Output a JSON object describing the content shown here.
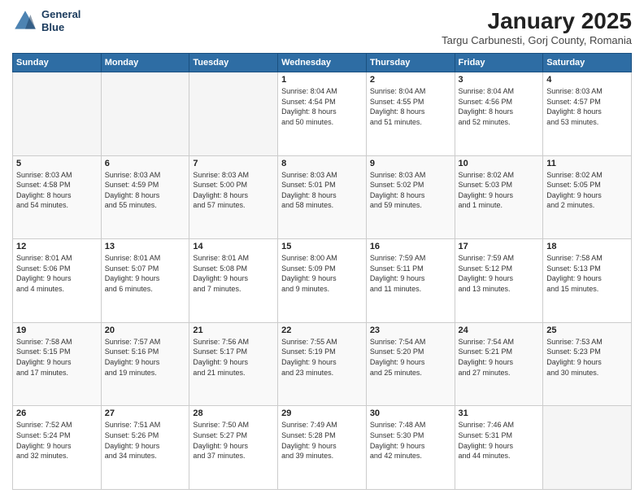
{
  "logo": {
    "line1": "General",
    "line2": "Blue"
  },
  "title": "January 2025",
  "subtitle": "Targu Carbunesti, Gorj County, Romania",
  "weekdays": [
    "Sunday",
    "Monday",
    "Tuesday",
    "Wednesday",
    "Thursday",
    "Friday",
    "Saturday"
  ],
  "weeks": [
    [
      {
        "day": "",
        "info": ""
      },
      {
        "day": "",
        "info": ""
      },
      {
        "day": "",
        "info": ""
      },
      {
        "day": "1",
        "info": "Sunrise: 8:04 AM\nSunset: 4:54 PM\nDaylight: 8 hours\nand 50 minutes."
      },
      {
        "day": "2",
        "info": "Sunrise: 8:04 AM\nSunset: 4:55 PM\nDaylight: 8 hours\nand 51 minutes."
      },
      {
        "day": "3",
        "info": "Sunrise: 8:04 AM\nSunset: 4:56 PM\nDaylight: 8 hours\nand 52 minutes."
      },
      {
        "day": "4",
        "info": "Sunrise: 8:03 AM\nSunset: 4:57 PM\nDaylight: 8 hours\nand 53 minutes."
      }
    ],
    [
      {
        "day": "5",
        "info": "Sunrise: 8:03 AM\nSunset: 4:58 PM\nDaylight: 8 hours\nand 54 minutes."
      },
      {
        "day": "6",
        "info": "Sunrise: 8:03 AM\nSunset: 4:59 PM\nDaylight: 8 hours\nand 55 minutes."
      },
      {
        "day": "7",
        "info": "Sunrise: 8:03 AM\nSunset: 5:00 PM\nDaylight: 8 hours\nand 57 minutes."
      },
      {
        "day": "8",
        "info": "Sunrise: 8:03 AM\nSunset: 5:01 PM\nDaylight: 8 hours\nand 58 minutes."
      },
      {
        "day": "9",
        "info": "Sunrise: 8:03 AM\nSunset: 5:02 PM\nDaylight: 8 hours\nand 59 minutes."
      },
      {
        "day": "10",
        "info": "Sunrise: 8:02 AM\nSunset: 5:03 PM\nDaylight: 9 hours\nand 1 minute."
      },
      {
        "day": "11",
        "info": "Sunrise: 8:02 AM\nSunset: 5:05 PM\nDaylight: 9 hours\nand 2 minutes."
      }
    ],
    [
      {
        "day": "12",
        "info": "Sunrise: 8:01 AM\nSunset: 5:06 PM\nDaylight: 9 hours\nand 4 minutes."
      },
      {
        "day": "13",
        "info": "Sunrise: 8:01 AM\nSunset: 5:07 PM\nDaylight: 9 hours\nand 6 minutes."
      },
      {
        "day": "14",
        "info": "Sunrise: 8:01 AM\nSunset: 5:08 PM\nDaylight: 9 hours\nand 7 minutes."
      },
      {
        "day": "15",
        "info": "Sunrise: 8:00 AM\nSunset: 5:09 PM\nDaylight: 9 hours\nand 9 minutes."
      },
      {
        "day": "16",
        "info": "Sunrise: 7:59 AM\nSunset: 5:11 PM\nDaylight: 9 hours\nand 11 minutes."
      },
      {
        "day": "17",
        "info": "Sunrise: 7:59 AM\nSunset: 5:12 PM\nDaylight: 9 hours\nand 13 minutes."
      },
      {
        "day": "18",
        "info": "Sunrise: 7:58 AM\nSunset: 5:13 PM\nDaylight: 9 hours\nand 15 minutes."
      }
    ],
    [
      {
        "day": "19",
        "info": "Sunrise: 7:58 AM\nSunset: 5:15 PM\nDaylight: 9 hours\nand 17 minutes."
      },
      {
        "day": "20",
        "info": "Sunrise: 7:57 AM\nSunset: 5:16 PM\nDaylight: 9 hours\nand 19 minutes."
      },
      {
        "day": "21",
        "info": "Sunrise: 7:56 AM\nSunset: 5:17 PM\nDaylight: 9 hours\nand 21 minutes."
      },
      {
        "day": "22",
        "info": "Sunrise: 7:55 AM\nSunset: 5:19 PM\nDaylight: 9 hours\nand 23 minutes."
      },
      {
        "day": "23",
        "info": "Sunrise: 7:54 AM\nSunset: 5:20 PM\nDaylight: 9 hours\nand 25 minutes."
      },
      {
        "day": "24",
        "info": "Sunrise: 7:54 AM\nSunset: 5:21 PM\nDaylight: 9 hours\nand 27 minutes."
      },
      {
        "day": "25",
        "info": "Sunrise: 7:53 AM\nSunset: 5:23 PM\nDaylight: 9 hours\nand 30 minutes."
      }
    ],
    [
      {
        "day": "26",
        "info": "Sunrise: 7:52 AM\nSunset: 5:24 PM\nDaylight: 9 hours\nand 32 minutes."
      },
      {
        "day": "27",
        "info": "Sunrise: 7:51 AM\nSunset: 5:26 PM\nDaylight: 9 hours\nand 34 minutes."
      },
      {
        "day": "28",
        "info": "Sunrise: 7:50 AM\nSunset: 5:27 PM\nDaylight: 9 hours\nand 37 minutes."
      },
      {
        "day": "29",
        "info": "Sunrise: 7:49 AM\nSunset: 5:28 PM\nDaylight: 9 hours\nand 39 minutes."
      },
      {
        "day": "30",
        "info": "Sunrise: 7:48 AM\nSunset: 5:30 PM\nDaylight: 9 hours\nand 42 minutes."
      },
      {
        "day": "31",
        "info": "Sunrise: 7:46 AM\nSunset: 5:31 PM\nDaylight: 9 hours\nand 44 minutes."
      },
      {
        "day": "",
        "info": ""
      }
    ]
  ]
}
